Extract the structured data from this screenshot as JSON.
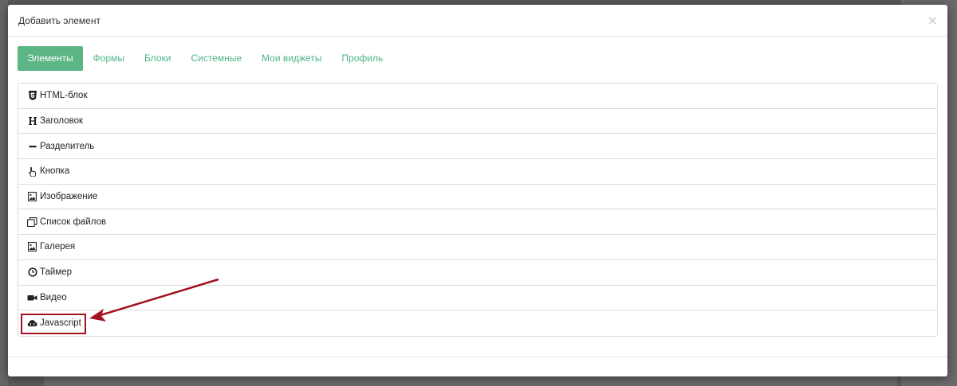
{
  "modal": {
    "title": "Добавить элемент",
    "close_glyph": "×"
  },
  "tabs": [
    {
      "label": "Элементы",
      "active": true
    },
    {
      "label": "Формы",
      "active": false
    },
    {
      "label": "Блоки",
      "active": false
    },
    {
      "label": "Системные",
      "active": false
    },
    {
      "label": "Мои виджеты",
      "active": false
    },
    {
      "label": "Профиль",
      "active": false
    }
  ],
  "items": [
    {
      "label": "HTML-блок",
      "icon": "html5-icon"
    },
    {
      "label": "Заголовок",
      "icon": "header-icon"
    },
    {
      "label": "Разделитель",
      "icon": "minus-icon"
    },
    {
      "label": "Кнопка",
      "icon": "hand-pointer-icon"
    },
    {
      "label": "Изображение",
      "icon": "image-icon"
    },
    {
      "label": "Список файлов",
      "icon": "files-icon"
    },
    {
      "label": "Галерея",
      "icon": "gallery-icon"
    },
    {
      "label": "Таймер",
      "icon": "clock-icon"
    },
    {
      "label": "Видео",
      "icon": "video-camera-icon"
    },
    {
      "label": "Javascript",
      "icon": "cloud-code-icon"
    }
  ],
  "colors": {
    "accent": "#5cb585",
    "tab_text": "#4fb487",
    "annotation": "#a3111f"
  }
}
